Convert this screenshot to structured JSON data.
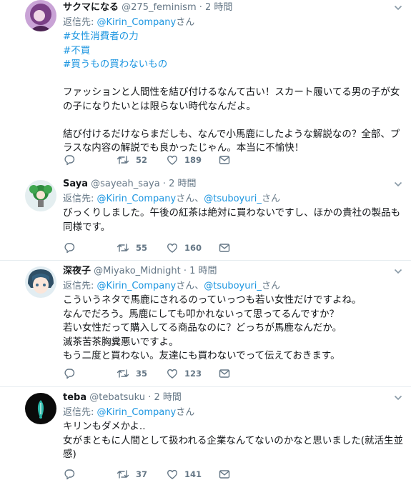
{
  "tweets": [
    {
      "name": "サクマになる",
      "handle": "@275_feminism",
      "dot": "·",
      "time": "2 時間",
      "reply_prefix": "返信先: ",
      "reply_targets": [
        "@Kirin_Company"
      ],
      "reply_suffix": "さん",
      "reply_joiner": "さん、",
      "hashtags": [
        "#女性消費者の力",
        "#不買",
        "#買うもの買わないもの"
      ],
      "lines": [
        "ファッションと人間性を結び付けるなんて古い！スカート履いてる男の子が女",
        "の子になりたいとは限らない時代なんだよ。",
        "",
        "結び付けるだけならまだしも、なんで小馬鹿にしたような解説なの？全部、プ",
        "ラスな内容の解説でも良かったじゃん。本当に不愉快！"
      ],
      "replies": "",
      "retweets": "52",
      "likes": "189"
    },
    {
      "name": "Saya",
      "handle": "@sayeah_saya",
      "dot": "·",
      "time": "2 時間",
      "reply_prefix": "返信先: ",
      "reply_targets": [
        "@Kirin_Company",
        "@tsuboyuri_"
      ],
      "reply_suffix": "さん",
      "reply_joiner": "さん、",
      "hashtags": [],
      "lines": [
        "びっくりしました。午後の紅茶は絶対に買わないですし、ほかの貴社の製品も",
        "同様です。"
      ],
      "replies": "",
      "retweets": "55",
      "likes": "160"
    },
    {
      "name": "深夜子",
      "handle": "@Miyako_Midnight",
      "dot": "·",
      "time": "1 時間",
      "reply_prefix": "返信先: ",
      "reply_targets": [
        "@Kirin_Company",
        "@tsuboyuri_"
      ],
      "reply_suffix": "さん",
      "reply_joiner": "さん、",
      "hashtags": [],
      "lines": [
        "こういうネタで馬鹿にされるのっていっつも若い女性だけですよね。",
        "なんでだろう。馬鹿にしても叩かれないって思ってるんですか？",
        "若い女性だって購入してる商品なのに？どっちが馬鹿なんだか。",
        "滅茶苦茶胸糞悪いですよ。",
        "もう二度と買わない。友達にも買わないでって伝えておきます。"
      ],
      "replies": "",
      "retweets": "35",
      "likes": "123"
    },
    {
      "name": "teba",
      "handle": "@tebatsuku",
      "dot": "·",
      "time": "2 時間",
      "reply_prefix": "返信先: ",
      "reply_targets": [
        "@Kirin_Company"
      ],
      "reply_suffix": "さん",
      "reply_joiner": "さん、",
      "hashtags": [],
      "lines": [
        "キリンもダメかよ..",
        "女がまともに人間として扱われる企業なんてないのかなと思いました(就活生並",
        "感)"
      ],
      "replies": "",
      "retweets": "37",
      "likes": "141"
    }
  ],
  "colors": {
    "link": "#1b95e0",
    "secondary": "#657786",
    "border": "#e6ecf0",
    "text": "#14171a"
  },
  "icons": {
    "reply": "reply-icon",
    "retweet": "retweet-icon",
    "like": "heart-icon",
    "dm": "envelope-icon",
    "menu": "chevron-down-icon"
  }
}
